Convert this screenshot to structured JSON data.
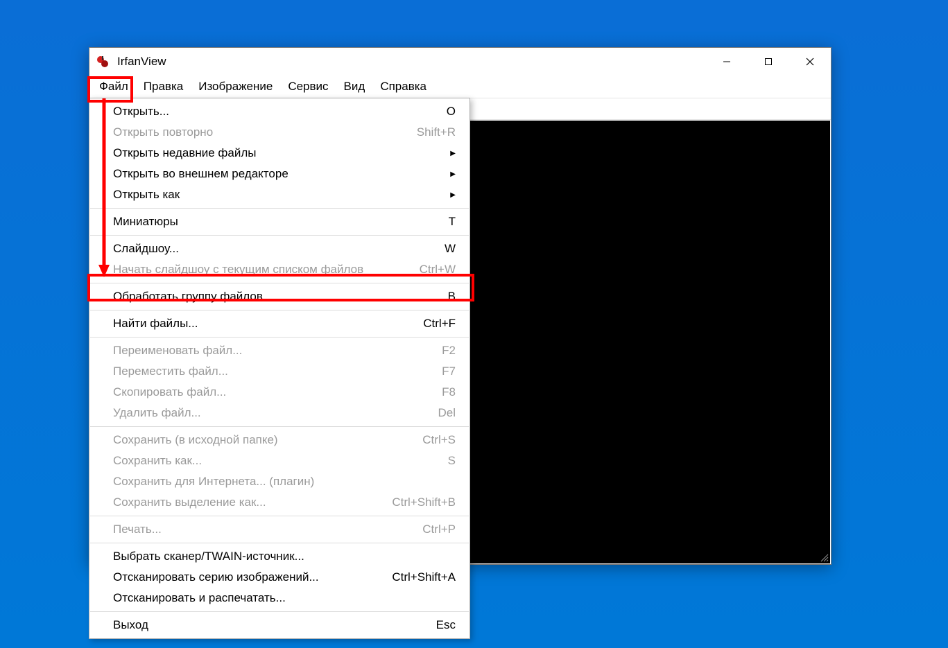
{
  "window": {
    "title": "IrfanView"
  },
  "menubar": [
    "Файл",
    "Правка",
    "Изображение",
    "Сервис",
    "Вид",
    "Справка"
  ],
  "file_menu": {
    "groups": [
      [
        {
          "label": "Открыть...",
          "shortcut": "O",
          "disabled": false,
          "submenu": false
        },
        {
          "label": "Открыть повторно",
          "shortcut": "Shift+R",
          "disabled": true,
          "submenu": false
        },
        {
          "label": "Открыть недавние файлы",
          "shortcut": "",
          "disabled": false,
          "submenu": true
        },
        {
          "label": "Открыть во внешнем редакторе",
          "shortcut": "",
          "disabled": false,
          "submenu": true
        },
        {
          "label": "Открыть как",
          "shortcut": "",
          "disabled": false,
          "submenu": true
        }
      ],
      [
        {
          "label": "Миниатюры",
          "shortcut": "T",
          "disabled": false,
          "submenu": false
        }
      ],
      [
        {
          "label": "Слайдшоу...",
          "shortcut": "W",
          "disabled": false,
          "submenu": false
        },
        {
          "label": "Начать слайдшоу с текущим списком файлов",
          "shortcut": "Ctrl+W",
          "disabled": true,
          "submenu": false
        }
      ],
      [
        {
          "label": "Обработать группу файлов...",
          "shortcut": "B",
          "disabled": false,
          "submenu": false
        }
      ],
      [
        {
          "label": "Найти файлы...",
          "shortcut": "Ctrl+F",
          "disabled": false,
          "submenu": false
        }
      ],
      [
        {
          "label": "Переименовать файл...",
          "shortcut": "F2",
          "disabled": true,
          "submenu": false
        },
        {
          "label": "Переместить файл...",
          "shortcut": "F7",
          "disabled": true,
          "submenu": false
        },
        {
          "label": "Скопировать файл...",
          "shortcut": "F8",
          "disabled": true,
          "submenu": false
        },
        {
          "label": "Удалить файл...",
          "shortcut": "Del",
          "disabled": true,
          "submenu": false
        }
      ],
      [
        {
          "label": "Сохранить (в исходной папке)",
          "shortcut": "Ctrl+S",
          "disabled": true,
          "submenu": false
        },
        {
          "label": "Сохранить как...",
          "shortcut": "S",
          "disabled": true,
          "submenu": false
        },
        {
          "label": "Сохранить для Интернета... (плагин)",
          "shortcut": "",
          "disabled": true,
          "submenu": false
        },
        {
          "label": "Сохранить выделение как...",
          "shortcut": "Ctrl+Shift+B",
          "disabled": true,
          "submenu": false
        }
      ],
      [
        {
          "label": "Печать...",
          "shortcut": "Ctrl+P",
          "disabled": true,
          "submenu": false
        }
      ],
      [
        {
          "label": "Выбрать сканер/TWAIN-источник...",
          "shortcut": "",
          "disabled": false,
          "submenu": false
        },
        {
          "label": "Отсканировать серию изображений...",
          "shortcut": "Ctrl+Shift+A",
          "disabled": false,
          "submenu": false
        },
        {
          "label": "Отсканировать и распечатать...",
          "shortcut": "",
          "disabled": false,
          "submenu": false
        }
      ],
      [
        {
          "label": "Выход",
          "shortcut": "Esc",
          "disabled": false,
          "submenu": false
        }
      ]
    ]
  },
  "toolbar_icons": [
    "open-icon",
    "thumbnails-icon",
    "slideshow-icon",
    "save-icon",
    "delete-icon",
    "cut-icon",
    "copy-icon",
    "paste-icon",
    "undo-icon",
    "info-icon",
    "zoom-in-icon",
    "zoom-out-icon",
    "prev-page-icon",
    "next-page-icon",
    "prev-file-icon",
    "next-file-icon",
    "first-icon",
    "last-icon",
    "settings-icon",
    "favorite-icon"
  ]
}
